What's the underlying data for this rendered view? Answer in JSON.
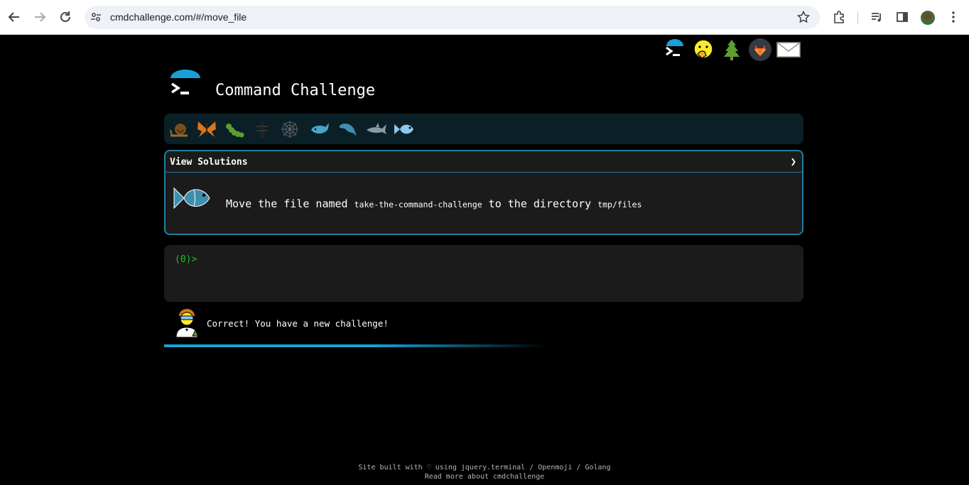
{
  "browser": {
    "url": "cmdchallenge.com/#/move_file"
  },
  "header": {
    "title": "Command Challenge"
  },
  "top_icons": [
    "terminal-logo-icon",
    "face-with-hand-over-mouth-icon",
    "evergreen-tree-icon",
    "gitlab-icon",
    "envelope-icon"
  ],
  "levels": [
    "snail-icon",
    "butterfly-icon",
    "caterpillar-icon",
    "ant-icon",
    "spider-web-icon",
    "whale-icon",
    "dolphin-icon",
    "shark-icon",
    "fish-icon"
  ],
  "challenge": {
    "view_solutions": "View Solutions",
    "chevron": "❯",
    "desc_before": "Move the file named",
    "file_name": "take-the-command-challenge",
    "desc_middle": "to the directory",
    "target_dir": "tmp/files"
  },
  "terminal": {
    "prompt": "(0)>"
  },
  "status": {
    "message": "Correct! You have a new challenge!"
  },
  "footer": {
    "line1": "Site built with ♡ using jquery.terminal / Openmoji / Golang",
    "line2": "Read more about cmdchallenge"
  },
  "colors": {
    "accent": "#1f7fa3",
    "prompt": "#1ec31e",
    "progress": "#1aa0d8"
  }
}
